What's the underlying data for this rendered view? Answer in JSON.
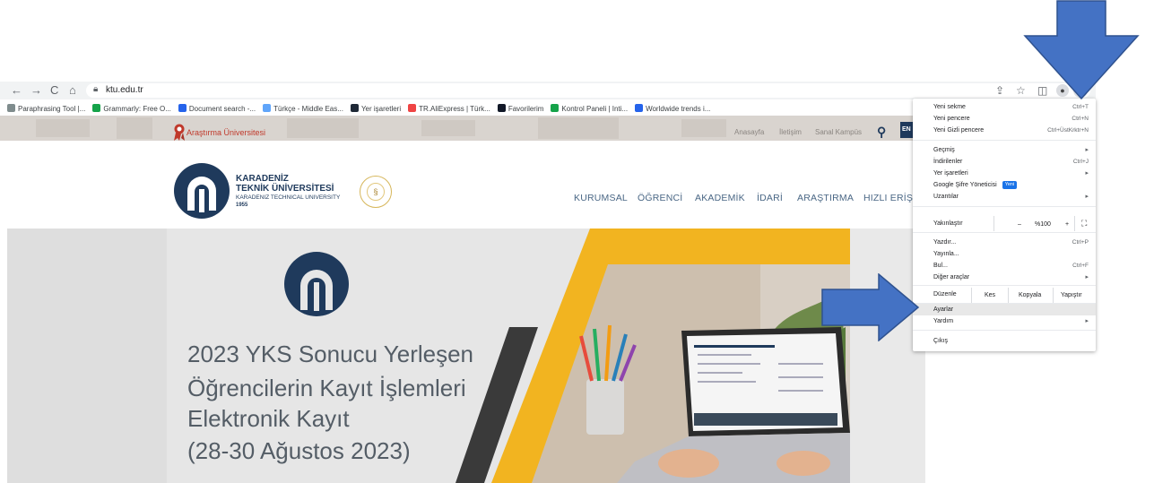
{
  "browser": {
    "nav": {
      "back": "←",
      "forward": "→",
      "reload": "C",
      "home": "⌂"
    },
    "url": "ktu.edu.tr",
    "toolbar_icons": {
      "share": "⇪",
      "star": "☆",
      "sidepanel": "◫",
      "profile": "●",
      "menu": "⋮"
    },
    "bookmarks": [
      {
        "label": "Paraphrasing Tool |...",
        "color": "#7f8c8d"
      },
      {
        "label": "Grammarly: Free O...",
        "color": "#15a34a"
      },
      {
        "label": "Document search -...",
        "color": "#2563eb"
      },
      {
        "label": "Türkçe - Middle Eas...",
        "color": "#60a5fa"
      },
      {
        "label": "Yer işaretleri",
        "color": "#1f2937"
      },
      {
        "label": "TR.AliExpress | Türk...",
        "color": "#ef4444"
      },
      {
        "label": "Favorilerim",
        "color": "#111827"
      },
      {
        "label": "Kontrol Paneli | Inti...",
        "color": "#16a34a"
      },
      {
        "label": "Worldwide trends i...",
        "color": "#2563eb"
      }
    ]
  },
  "site": {
    "research_label": "Araştırma Üniversitesi",
    "top_links": [
      "Anasayfa",
      "İletişim",
      "Sanal Kampüs"
    ],
    "lang": "EN",
    "brand": {
      "line1": "KARADENİZ",
      "line2": "TEKNİK ÜNİVERSİTESİ",
      "line3": "KARADENIZ TECHNICAL UNIVERSITY",
      "year": "1955"
    },
    "menu": [
      "KURUMSAL",
      "ÖĞRENCİ",
      "AKADEMİK",
      "İDARİ",
      "ARAŞTIRMA",
      "HIZLI ERİŞİM"
    ],
    "hero_lines": [
      "2023 YKS Sonucu Yerleşen",
      "Öğrencilerin Kayıt İşlemleri",
      "Elektronik Kayıt",
      "(28-30 Ağustos 2023)"
    ]
  },
  "context_menu": {
    "items_top": [
      {
        "label": "Yeni sekme",
        "shortcut": "Ctrl+T"
      },
      {
        "label": "Yeni pencere",
        "shortcut": "Ctrl+N"
      },
      {
        "label": "Yeni Gizli pencere",
        "shortcut": "Ctrl+ÜstKrktr+N"
      }
    ],
    "items_mid": [
      {
        "label": "Geçmiş",
        "shortcut": "▸"
      },
      {
        "label": "İndirilenler",
        "shortcut": "Ctrl+J"
      },
      {
        "label": "Yer işaretleri",
        "shortcut": "▸"
      },
      {
        "label": "Google Şifre Yöneticisi",
        "shortcut": ""
      },
      {
        "label": "Uzantılar",
        "shortcut": "▸"
      }
    ],
    "new_badge": "Yeni",
    "zoom": {
      "label": "Yakınlaştır",
      "minus": "–",
      "value": "%100",
      "plus": "+",
      "fullscreen": "⛶"
    },
    "items_tools": [
      {
        "label": "Yazdır...",
        "shortcut": "Ctrl+P"
      },
      {
        "label": "Yayınla...",
        "shortcut": ""
      },
      {
        "label": "Bul...",
        "shortcut": "Ctrl+F"
      },
      {
        "label": "Diğer araçlar",
        "shortcut": "▸"
      }
    ],
    "edit": {
      "label": "Düzenle",
      "cut": "Kes",
      "copy": "Kopyala",
      "paste": "Yapıştır"
    },
    "items_settings": [
      {
        "label": "Ayarlar",
        "shortcut": ""
      },
      {
        "label": "Yardım",
        "shortcut": "▸"
      }
    ],
    "exit": "Çıkış"
  },
  "colors": {
    "annotation_arrow": "#4472c4",
    "brand_navy": "#1f3a5c",
    "hero_yellow": "#f2b420"
  }
}
